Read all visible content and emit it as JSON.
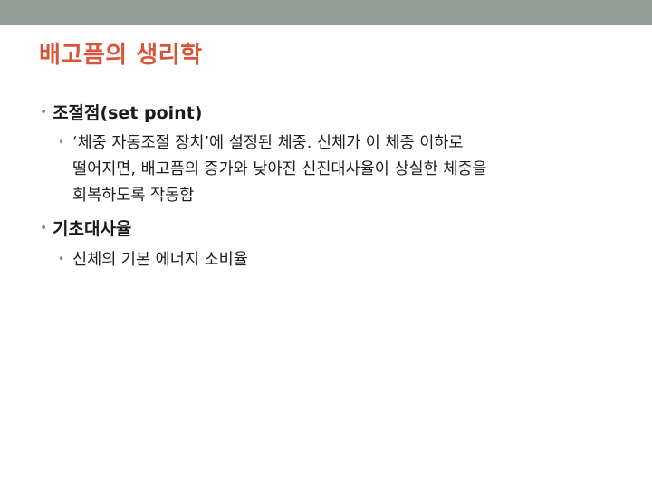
{
  "slide": {
    "title": "배고픔의 생리학",
    "items": [
      {
        "heading": "조절점(set point)",
        "sub": [
          {
            "lines": [
              "‘체중 자동조절 장치’에 설정된 체중. 신체가 이 체중 이하로",
              "떨어지면, 배고픔의 증가와 낮아진 신진대사율이 상실한 체중을",
              "회복하도록 작동함"
            ]
          }
        ]
      },
      {
        "heading": "기초대사율",
        "sub": [
          {
            "lines": [
              "신체의 기본 에너지 소비율"
            ]
          }
        ]
      }
    ]
  },
  "colors": {
    "top_bar": "#929e97",
    "title": "#d9553a",
    "bullet": "#8a8a8a",
    "text": "#1a1a1a"
  }
}
